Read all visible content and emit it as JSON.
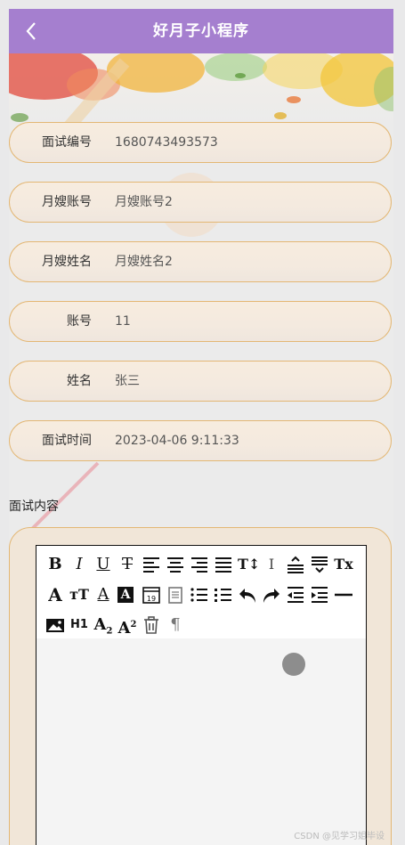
{
  "header": {
    "title": "好月子小程序"
  },
  "fields": [
    {
      "label": "面试编号",
      "value": "1680743493573"
    },
    {
      "label": "月嫂账号",
      "value": "月嫂账号2"
    },
    {
      "label": "月嫂姓名",
      "value": "月嫂姓名2"
    },
    {
      "label": "账号",
      "value": "11"
    },
    {
      "label": "姓名",
      "value": "张三"
    },
    {
      "label": "面试时间",
      "value": "2023-04-06 9:11:33"
    }
  ],
  "content": {
    "label": "面试内容"
  },
  "editor": {
    "toolbar_icons": [
      "bold-icon",
      "italic-icon",
      "underline-icon",
      "strikethrough-icon",
      "align-left-icon",
      "align-center-icon",
      "align-right-icon",
      "align-justify-icon",
      "font-size-icon",
      "line-height-icon",
      "paragraph-spacing-top-icon",
      "paragraph-spacing-bottom-icon",
      "clear-format-icon",
      "font-family-icon",
      "font-size-small-icon",
      "font-color-icon",
      "background-color-icon",
      "date-icon",
      "paste-icon",
      "ordered-list-icon",
      "unordered-list-icon",
      "undo-icon",
      "redo-icon",
      "outdent-icon",
      "indent-icon",
      "horizontal-rule-icon",
      "image-icon",
      "heading-icon",
      "subscript-icon",
      "superscript-icon",
      "delete-icon",
      "paragraph-icon"
    ],
    "h1_text": "H1"
  },
  "watermark": "CSDN @见学习姐毕设"
}
